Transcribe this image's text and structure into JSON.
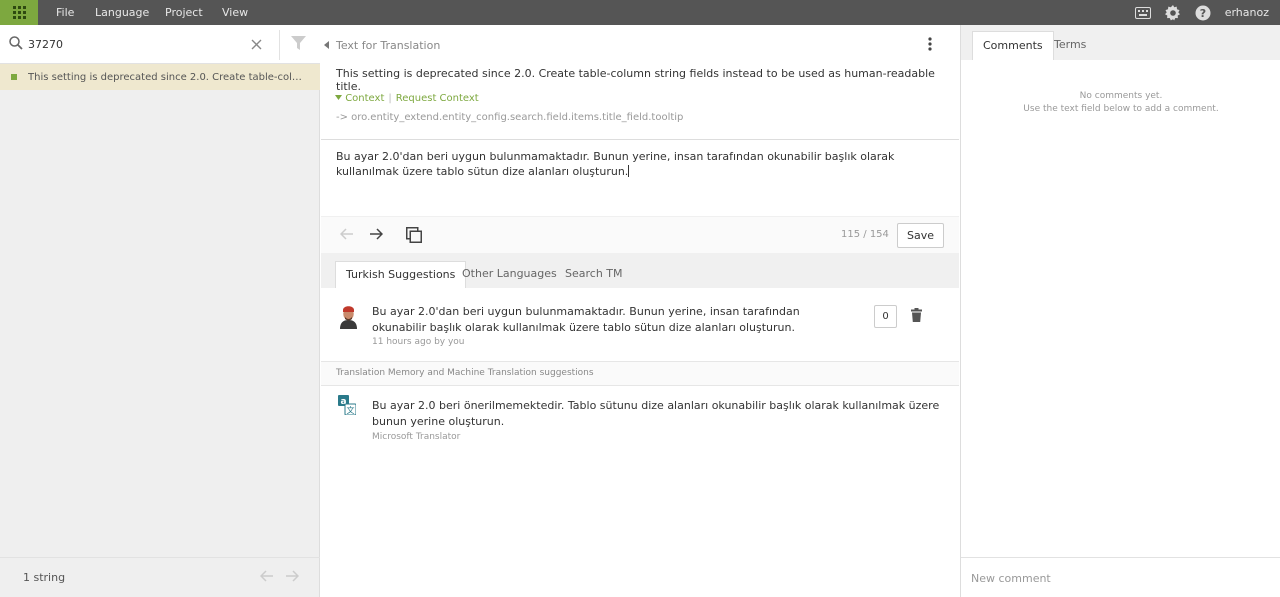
{
  "menu": {
    "file": "File",
    "language": "Language",
    "project": "Project",
    "view": "View"
  },
  "user": {
    "name": "erhanoz"
  },
  "colors": {
    "accent": "#7da83f",
    "topbar": "#555555",
    "selected_row": "#efe8cf"
  },
  "search": {
    "value": "37270"
  },
  "strings": {
    "items": [
      {
        "text": "This setting is deprecated since 2.0. Create table-column string fields instead to be used as human-readable title."
      }
    ],
    "count": "1 string"
  },
  "source": {
    "label": "Text for Translation",
    "text": "This setting is deprecated since 2.0. Create table-column string fields instead to be used as human-readable title.",
    "context_label": "Context",
    "request_context_label": "Request Context",
    "context_key": "-> oro.entity_extend.entity_config.search.field.items.title_field.tooltip"
  },
  "translation": {
    "text": "Bu ayar 2.0'dan beri uygun bulunmamaktadır. Bunun yerine, insan tarafından okunabilir başlık olarak kullanılmak üzere tablo sütun dize alanları oluşturun.",
    "char_count": "115 / 154",
    "save_label": "Save"
  },
  "tabs": {
    "turkish": "Turkish Suggestions",
    "other": "Other Languages",
    "search_tm": "Search TM"
  },
  "suggestion": {
    "text": "Bu ayar 2.0'dan beri uygun bulunmamaktadır. Bunun yerine, insan tarafından okunabilir başlık olarak kullanılmak üzere tablo sütun dize alanları oluşturun.",
    "meta": "11 hours ago by you",
    "votes": "0"
  },
  "tm": {
    "header": "Translation Memory and Machine Translation suggestions",
    "text": "Bu ayar 2.0 beri önerilmemektedir. Tablo sütunu dize alanları okunabilir başlık olarak kullanılmak üzere bunun yerine oluşturun.",
    "source": "Microsoft Translator"
  },
  "comments": {
    "tab_comments": "Comments",
    "tab_terms": "Terms",
    "empty_line1": "No comments yet.",
    "empty_line2": "Use the text field below to add a comment.",
    "placeholder": "New comment"
  }
}
